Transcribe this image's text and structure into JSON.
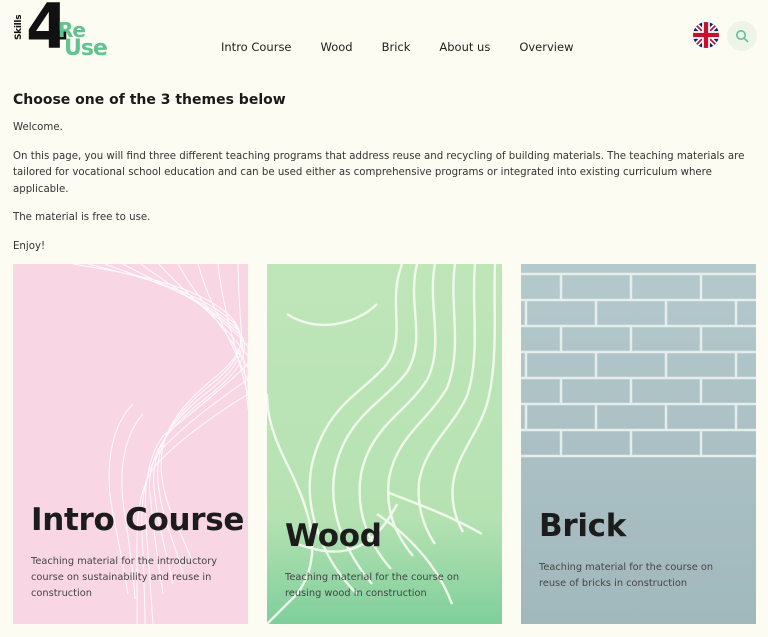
{
  "logo": {
    "skills": "Skills",
    "number": "4",
    "re": "Re",
    "use": "Use"
  },
  "nav": {
    "items": [
      {
        "label": "Intro Course"
      },
      {
        "label": "Wood"
      },
      {
        "label": "Brick"
      },
      {
        "label": "About us"
      },
      {
        "label": "Overview"
      }
    ]
  },
  "header_icons": {
    "language": "uk-flag-icon",
    "search": "search-icon"
  },
  "intro": {
    "heading": "Choose one of the 3 themes below",
    "paragraphs": [
      "Welcome.",
      "On this page, you will find three different teaching programs that address reuse and recycling of building materials. The teaching materials are tailored for vocational school education and can be used either as comprehensive programs or integrated into existing curriculum where applicable.",
      "The material is free to use.",
      "Enjoy!"
    ]
  },
  "cards": [
    {
      "title": "Intro Course",
      "description": "Teaching material for the introductory course on sustainability and reuse in construction",
      "color": "#f9d6e4"
    },
    {
      "title": "Wood",
      "description": "Teaching material for the course on reusing wood in construction",
      "color": "#bfe6b9"
    },
    {
      "title": "Brick",
      "description": "Teaching material for the course on reuse of bricks in construction",
      "color": "#b4c9cc"
    }
  ],
  "colors": {
    "background": "#fdfcf3",
    "accent": "#5fc48f"
  }
}
